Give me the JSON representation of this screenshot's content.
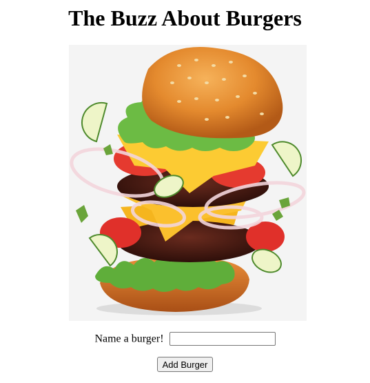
{
  "header": {
    "title": "The Buzz About Burgers"
  },
  "hero": {
    "image": "burger-illustration"
  },
  "form": {
    "label": "Name a burger!",
    "input_value": "",
    "input_placeholder": "",
    "submit_label": "Add Burger"
  }
}
